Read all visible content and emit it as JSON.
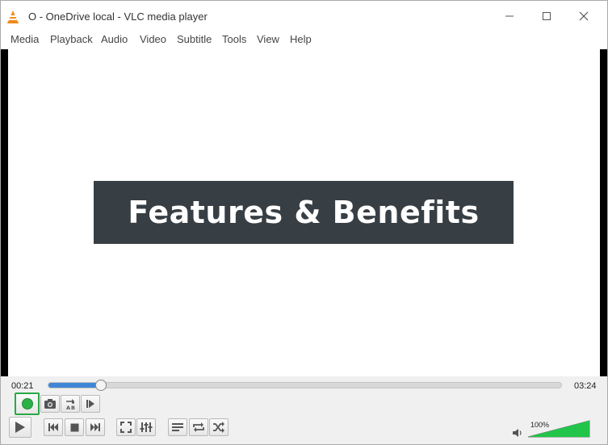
{
  "window": {
    "title": "O - OneDrive local - VLC media player",
    "controls": {
      "minimize": "—",
      "maximize": "☐",
      "close": "✕"
    }
  },
  "menu": {
    "items": [
      "Media",
      "Playback",
      "Audio",
      "Video",
      "Subtitle",
      "Tools",
      "View",
      "Help"
    ]
  },
  "video": {
    "banner_text": "Features & Benefits"
  },
  "playback": {
    "elapsed": "00:21",
    "total": "03:24",
    "progress": 0.103
  },
  "volume": {
    "label": "100%",
    "level": 1.0
  },
  "colors": {
    "accent": "#3f87d6",
    "record_highlight": "#2aa845",
    "banner_bg": "#373e44",
    "volume_green": "#22c54a"
  }
}
